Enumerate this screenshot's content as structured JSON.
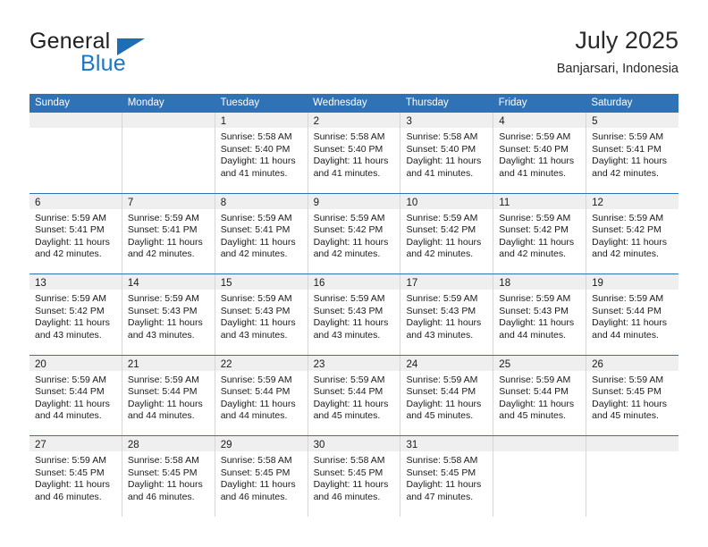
{
  "brand": {
    "name_part1": "General",
    "name_part2": "Blue",
    "triangle_icon": "triangle-icon",
    "colors": {
      "general": "#231f20",
      "blue": "#1b76c4",
      "triangle": "#1f6eb5"
    }
  },
  "header": {
    "title": "July 2025",
    "subtitle": "Banjarsari, Indonesia"
  },
  "theme": {
    "header_blue": "#2f72b5",
    "day_strip_gray": "#efefef",
    "cell_border": "#d6d6d6",
    "row_divider": "#2f72b5"
  },
  "calendar": {
    "weekday_headers": [
      "Sunday",
      "Monday",
      "Tuesday",
      "Wednesday",
      "Thursday",
      "Friday",
      "Saturday"
    ],
    "weeks": [
      [
        {
          "day": "",
          "sunrise": "",
          "sunset": "",
          "daylight": ""
        },
        {
          "day": "",
          "sunrise": "",
          "sunset": "",
          "daylight": ""
        },
        {
          "day": "1",
          "sunrise": "Sunrise: 5:58 AM",
          "sunset": "Sunset: 5:40 PM",
          "daylight": "Daylight: 11 hours and 41 minutes."
        },
        {
          "day": "2",
          "sunrise": "Sunrise: 5:58 AM",
          "sunset": "Sunset: 5:40 PM",
          "daylight": "Daylight: 11 hours and 41 minutes."
        },
        {
          "day": "3",
          "sunrise": "Sunrise: 5:58 AM",
          "sunset": "Sunset: 5:40 PM",
          "daylight": "Daylight: 11 hours and 41 minutes."
        },
        {
          "day": "4",
          "sunrise": "Sunrise: 5:59 AM",
          "sunset": "Sunset: 5:40 PM",
          "daylight": "Daylight: 11 hours and 41 minutes."
        },
        {
          "day": "5",
          "sunrise": "Sunrise: 5:59 AM",
          "sunset": "Sunset: 5:41 PM",
          "daylight": "Daylight: 11 hours and 42 minutes."
        }
      ],
      [
        {
          "day": "6",
          "sunrise": "Sunrise: 5:59 AM",
          "sunset": "Sunset: 5:41 PM",
          "daylight": "Daylight: 11 hours and 42 minutes."
        },
        {
          "day": "7",
          "sunrise": "Sunrise: 5:59 AM",
          "sunset": "Sunset: 5:41 PM",
          "daylight": "Daylight: 11 hours and 42 minutes."
        },
        {
          "day": "8",
          "sunrise": "Sunrise: 5:59 AM",
          "sunset": "Sunset: 5:41 PM",
          "daylight": "Daylight: 11 hours and 42 minutes."
        },
        {
          "day": "9",
          "sunrise": "Sunrise: 5:59 AM",
          "sunset": "Sunset: 5:42 PM",
          "daylight": "Daylight: 11 hours and 42 minutes."
        },
        {
          "day": "10",
          "sunrise": "Sunrise: 5:59 AM",
          "sunset": "Sunset: 5:42 PM",
          "daylight": "Daylight: 11 hours and 42 minutes."
        },
        {
          "day": "11",
          "sunrise": "Sunrise: 5:59 AM",
          "sunset": "Sunset: 5:42 PM",
          "daylight": "Daylight: 11 hours and 42 minutes."
        },
        {
          "day": "12",
          "sunrise": "Sunrise: 5:59 AM",
          "sunset": "Sunset: 5:42 PM",
          "daylight": "Daylight: 11 hours and 42 minutes."
        }
      ],
      [
        {
          "day": "13",
          "sunrise": "Sunrise: 5:59 AM",
          "sunset": "Sunset: 5:42 PM",
          "daylight": "Daylight: 11 hours and 43 minutes."
        },
        {
          "day": "14",
          "sunrise": "Sunrise: 5:59 AM",
          "sunset": "Sunset: 5:43 PM",
          "daylight": "Daylight: 11 hours and 43 minutes."
        },
        {
          "day": "15",
          "sunrise": "Sunrise: 5:59 AM",
          "sunset": "Sunset: 5:43 PM",
          "daylight": "Daylight: 11 hours and 43 minutes."
        },
        {
          "day": "16",
          "sunrise": "Sunrise: 5:59 AM",
          "sunset": "Sunset: 5:43 PM",
          "daylight": "Daylight: 11 hours and 43 minutes."
        },
        {
          "day": "17",
          "sunrise": "Sunrise: 5:59 AM",
          "sunset": "Sunset: 5:43 PM",
          "daylight": "Daylight: 11 hours and 43 minutes."
        },
        {
          "day": "18",
          "sunrise": "Sunrise: 5:59 AM",
          "sunset": "Sunset: 5:43 PM",
          "daylight": "Daylight: 11 hours and 44 minutes."
        },
        {
          "day": "19",
          "sunrise": "Sunrise: 5:59 AM",
          "sunset": "Sunset: 5:44 PM",
          "daylight": "Daylight: 11 hours and 44 minutes."
        }
      ],
      [
        {
          "day": "20",
          "sunrise": "Sunrise: 5:59 AM",
          "sunset": "Sunset: 5:44 PM",
          "daylight": "Daylight: 11 hours and 44 minutes."
        },
        {
          "day": "21",
          "sunrise": "Sunrise: 5:59 AM",
          "sunset": "Sunset: 5:44 PM",
          "daylight": "Daylight: 11 hours and 44 minutes."
        },
        {
          "day": "22",
          "sunrise": "Sunrise: 5:59 AM",
          "sunset": "Sunset: 5:44 PM",
          "daylight": "Daylight: 11 hours and 44 minutes."
        },
        {
          "day": "23",
          "sunrise": "Sunrise: 5:59 AM",
          "sunset": "Sunset: 5:44 PM",
          "daylight": "Daylight: 11 hours and 45 minutes."
        },
        {
          "day": "24",
          "sunrise": "Sunrise: 5:59 AM",
          "sunset": "Sunset: 5:44 PM",
          "daylight": "Daylight: 11 hours and 45 minutes."
        },
        {
          "day": "25",
          "sunrise": "Sunrise: 5:59 AM",
          "sunset": "Sunset: 5:44 PM",
          "daylight": "Daylight: 11 hours and 45 minutes."
        },
        {
          "day": "26",
          "sunrise": "Sunrise: 5:59 AM",
          "sunset": "Sunset: 5:45 PM",
          "daylight": "Daylight: 11 hours and 45 minutes."
        }
      ],
      [
        {
          "day": "27",
          "sunrise": "Sunrise: 5:59 AM",
          "sunset": "Sunset: 5:45 PM",
          "daylight": "Daylight: 11 hours and 46 minutes."
        },
        {
          "day": "28",
          "sunrise": "Sunrise: 5:58 AM",
          "sunset": "Sunset: 5:45 PM",
          "daylight": "Daylight: 11 hours and 46 minutes."
        },
        {
          "day": "29",
          "sunrise": "Sunrise: 5:58 AM",
          "sunset": "Sunset: 5:45 PM",
          "daylight": "Daylight: 11 hours and 46 minutes."
        },
        {
          "day": "30",
          "sunrise": "Sunrise: 5:58 AM",
          "sunset": "Sunset: 5:45 PM",
          "daylight": "Daylight: 11 hours and 46 minutes."
        },
        {
          "day": "31",
          "sunrise": "Sunrise: 5:58 AM",
          "sunset": "Sunset: 5:45 PM",
          "daylight": "Daylight: 11 hours and 47 minutes."
        },
        {
          "day": "",
          "sunrise": "",
          "sunset": "",
          "daylight": ""
        },
        {
          "day": "",
          "sunrise": "",
          "sunset": "",
          "daylight": ""
        }
      ]
    ]
  }
}
